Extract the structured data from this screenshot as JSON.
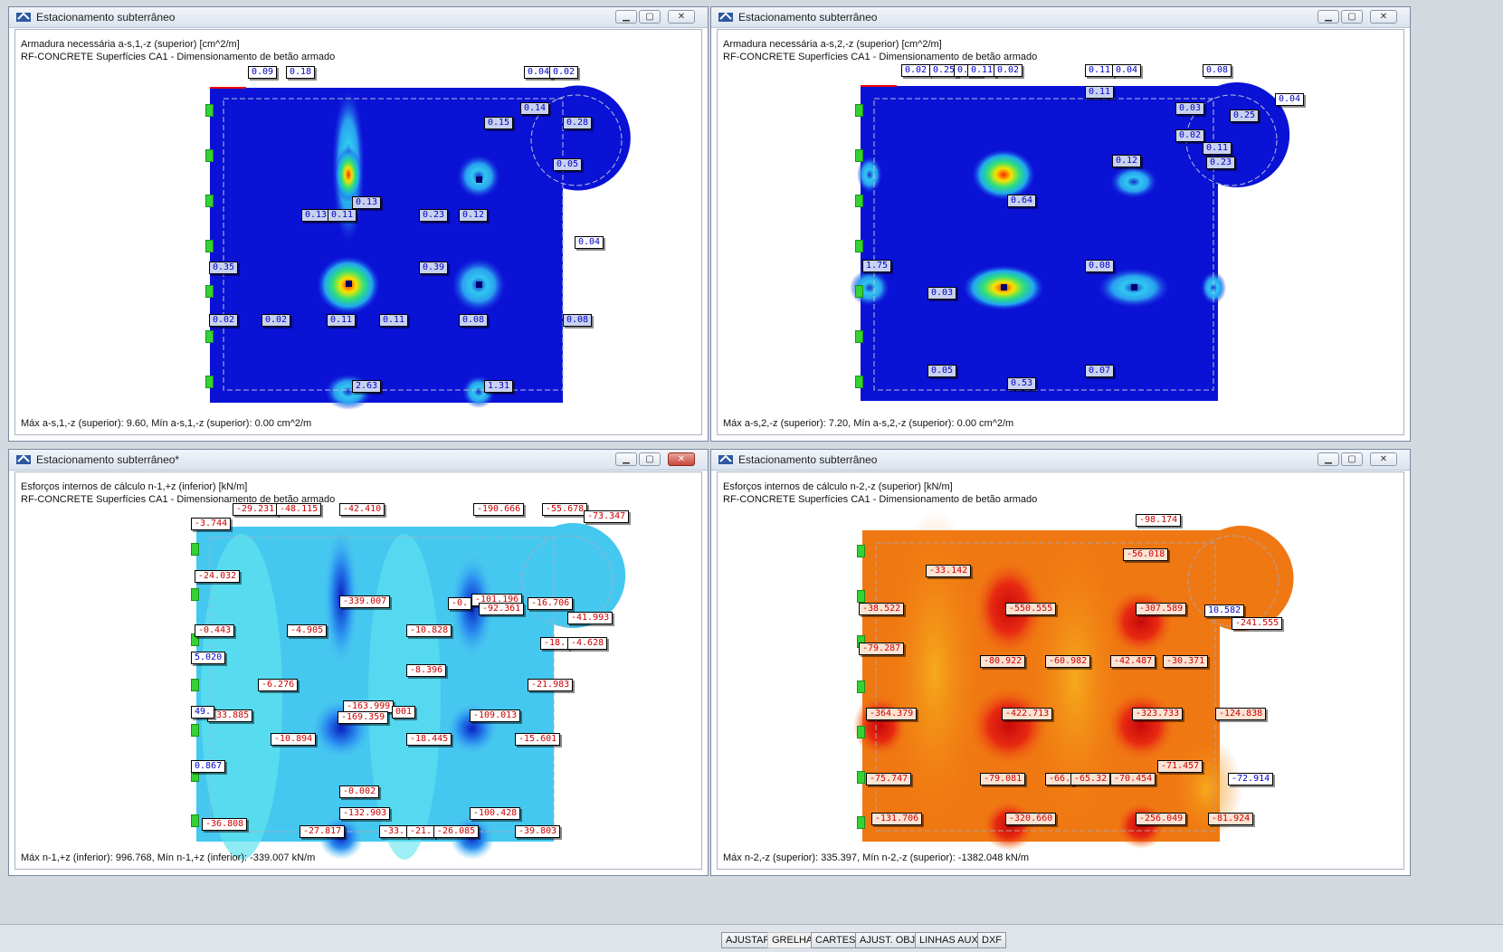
{
  "windows": [
    {
      "title": "Estacionamento subterrâneo",
      "header_line1": "Armadura necessária a-s,1,-z (superior) [cm^2/m]",
      "header_line2": "RF-CONCRETE Superfícies CA1 - Dimensionamento de betão armado",
      "footer": "Máx a-s,1,-z (superior): 9.60, Mín a-s,1,-z (superior): 0.00 cm^2/m",
      "labels": [
        "0.09",
        "0.18",
        "0.04",
        "0.02",
        "0.14",
        "0.15",
        "0.28",
        "0.05",
        "0.13",
        "0.13",
        "0.11",
        "0.23",
        "0.12",
        "0.04",
        "0.35",
        "0.39",
        "0.02",
        "0.02",
        "0.11",
        "0.11",
        "0.08",
        "0.08",
        "2.63",
        "1.31"
      ]
    },
    {
      "title": "Estacionamento subterrâneo",
      "header_line1": "Armadura necessária a-s,2,-z (superior) [cm^2/m]",
      "header_line2": "RF-CONCRETE Superfícies CA1 - Dimensionamento de betão armado",
      "footer": "Máx a-s,2,-z (superior): 7.20, Mín a-s,2,-z (superior): 0.00 cm^2/m",
      "labels": [
        "0.02",
        "0.25",
        "0.04",
        "0.11",
        "0.02",
        "0.11",
        "0.04",
        "0.08",
        "0.11",
        "0.04",
        "0.03",
        "0.25",
        "0.02",
        "0.11",
        "0.23",
        "0.12",
        "0.64",
        "1.75",
        "0.08",
        "0.03",
        "0.05",
        "0.53",
        "0.07"
      ]
    },
    {
      "title": "Estacionamento subterrâneo*",
      "header_line1": "Esforços internos de cálculo n-1,+z (inferior) [kN/m]",
      "header_line2": "RF-CONCRETE Superfícies CA1 - Dimensionamento de betão armado",
      "footer": "Máx n-1,+z (inferior): 996.768, Mín n-1,+z (inferior): -339.007 kN/m",
      "labels": [
        "-3.744",
        "-29.231",
        "-48.115",
        "-42.410",
        "-190.666",
        "-55.678",
        "-73.347",
        "-24.032",
        "-339.007",
        "-0.",
        "-101.196",
        "-92.361",
        "-16.706",
        "-41.993",
        "-0.443",
        "-4.905",
        "-10.828",
        "-18.",
        "-4.628",
        "5.020",
        "-8.396",
        "-6.276",
        "-21.983",
        "-163.999",
        "-33.885",
        "-169.359",
        "-109.013",
        "-10.894",
        "-18.445",
        "-15.601",
        "0.867",
        "-0.002",
        "-132.903",
        "-100.428",
        "-36.808",
        "-27.817",
        "-33.",
        "-21.",
        "-26.085",
        "-39.803",
        "49.",
        "001"
      ]
    },
    {
      "title": "Estacionamento subterrâneo",
      "header_line1": "Esforços internos de cálculo n-2,-z (superior) [kN/m]",
      "header_line2": "RF-CONCRETE Superfícies CA1 - Dimensionamento de betão armado",
      "footer": "Máx n-2,-z (superior): 335.397, Mín n-2,-z (superior): -1382.048 kN/m",
      "labels": [
        "-98.174",
        "-56.018",
        "-33.142",
        "-550.555",
        "-307.589",
        "-38.522",
        "10.582",
        "-241.555",
        "-79.287",
        "-80.922",
        "-60.982",
        "-42.487",
        "-30.371",
        "-364.379",
        "-422.713",
        "-323.733",
        "-124.838",
        "-71.457",
        "-75.747",
        "-79.081",
        "-66.",
        "-65.32",
        "-70.454",
        "-72.914",
        "-131.706",
        "-320.660",
        "-256.049",
        "-81.924"
      ]
    }
  ],
  "statusbar": {
    "buttons": [
      "AJUSTAR",
      "GRELHA",
      "CARTES",
      "AJUST. OBJ.",
      "LINHAS AUX.",
      "DXF"
    ]
  },
  "colors": {
    "contour_blue": "#0a0fd6",
    "contour_cyan": "#3fd7f0",
    "contour_orange": "#f07a10",
    "contour_red": "#e3241a",
    "label_red": "#cc0000",
    "label_blue": "#0000c8"
  }
}
